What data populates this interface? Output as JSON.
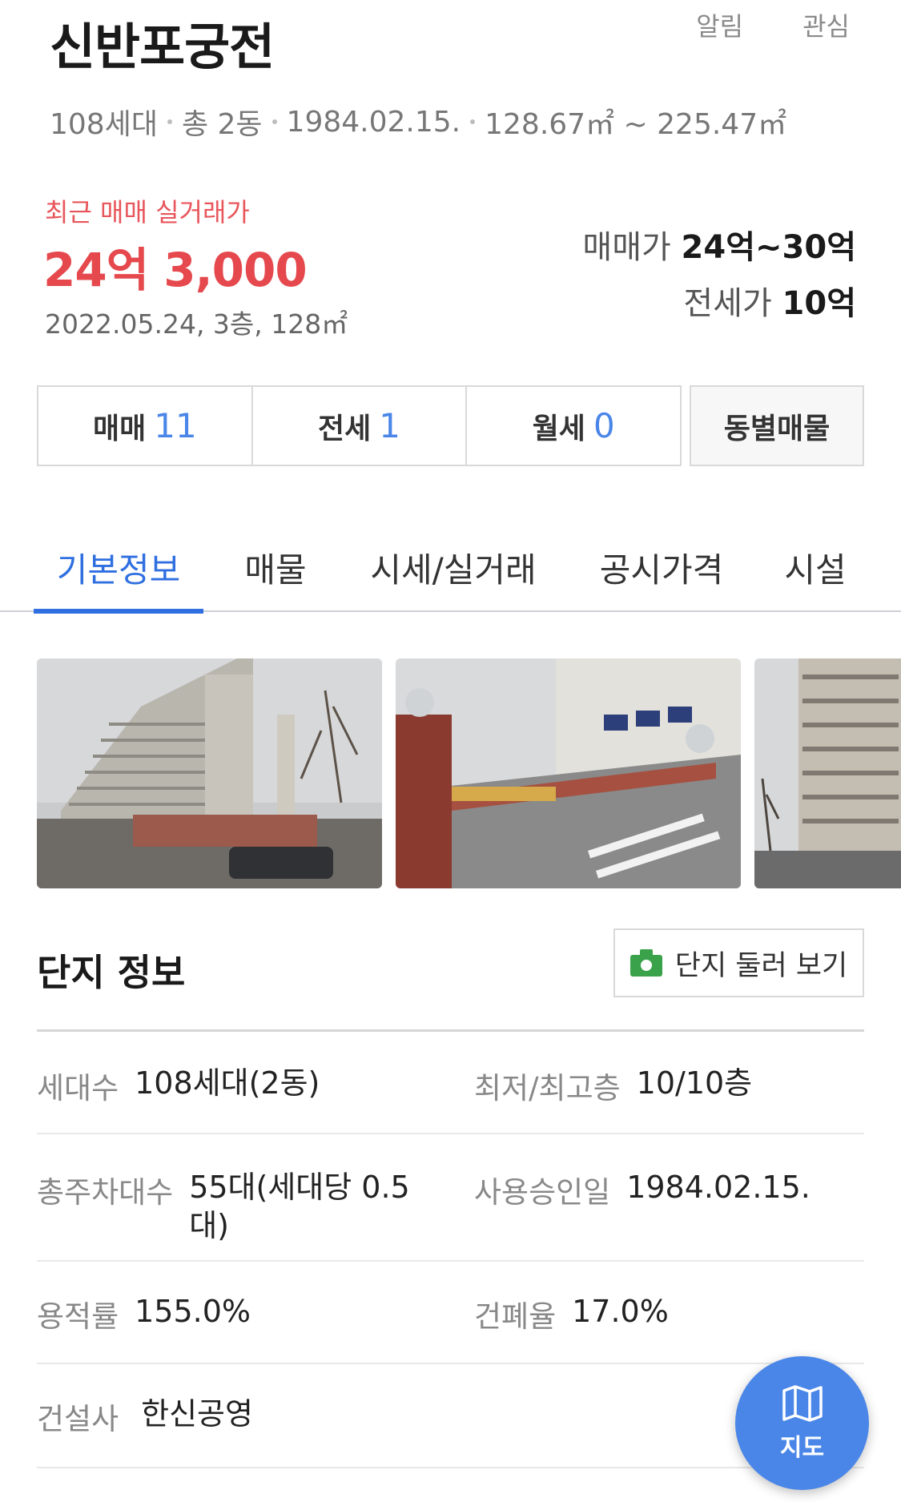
{
  "header": {
    "title": "신반포궁전",
    "actions": {
      "alert": "알림",
      "favorite": "관심"
    },
    "summary": {
      "units": "108세대",
      "buildings": "총 2동",
      "approved": "1984.02.15.",
      "area": "128.67㎡ ~ 225.47㎡"
    }
  },
  "recent_deal": {
    "label": "최근 매매 실거래가",
    "price": "24억 3,000",
    "meta": "2022.05.24, 3층, 128㎡"
  },
  "price_range": {
    "sale_label": "매매가",
    "sale_value": "24억~30억",
    "jeonse_label": "전세가",
    "jeonse_value": "10억"
  },
  "deal_tabs": [
    {
      "label": "매매",
      "count": "11"
    },
    {
      "label": "전세",
      "count": "1"
    },
    {
      "label": "월세",
      "count": "0"
    }
  ],
  "dong_button": "동별매물",
  "main_tabs": [
    {
      "label": "기본정보",
      "active": true
    },
    {
      "label": "매물"
    },
    {
      "label": "시세/실거래"
    },
    {
      "label": "공시가격"
    },
    {
      "label": "시설"
    }
  ],
  "complex_info": {
    "title": "단지 정보",
    "tour_button": "단지 둘러 보기",
    "rows": [
      {
        "l_label": "세대수",
        "l_value": "108세대(2동)",
        "r_label": "최저/최고층",
        "r_value": "10/10층"
      },
      {
        "l_label": "총주차대수",
        "l_value": "55대(세대당 0.5대)",
        "r_label": "사용승인일",
        "r_value": "1984.02.15."
      },
      {
        "l_label": "용적률",
        "l_value": "155.0%",
        "r_label": "건폐율",
        "r_value": "17.0%"
      },
      {
        "l_label": "건설사",
        "l_value": "한신공영",
        "r_label": "",
        "r_value": ""
      }
    ]
  },
  "map_fab": {
    "label": "지도"
  },
  "colors": {
    "accent_blue": "#2f6fe0",
    "price_red": "#e5484d",
    "fab_blue": "#4a86e8",
    "camera_green": "#3aa24a"
  }
}
